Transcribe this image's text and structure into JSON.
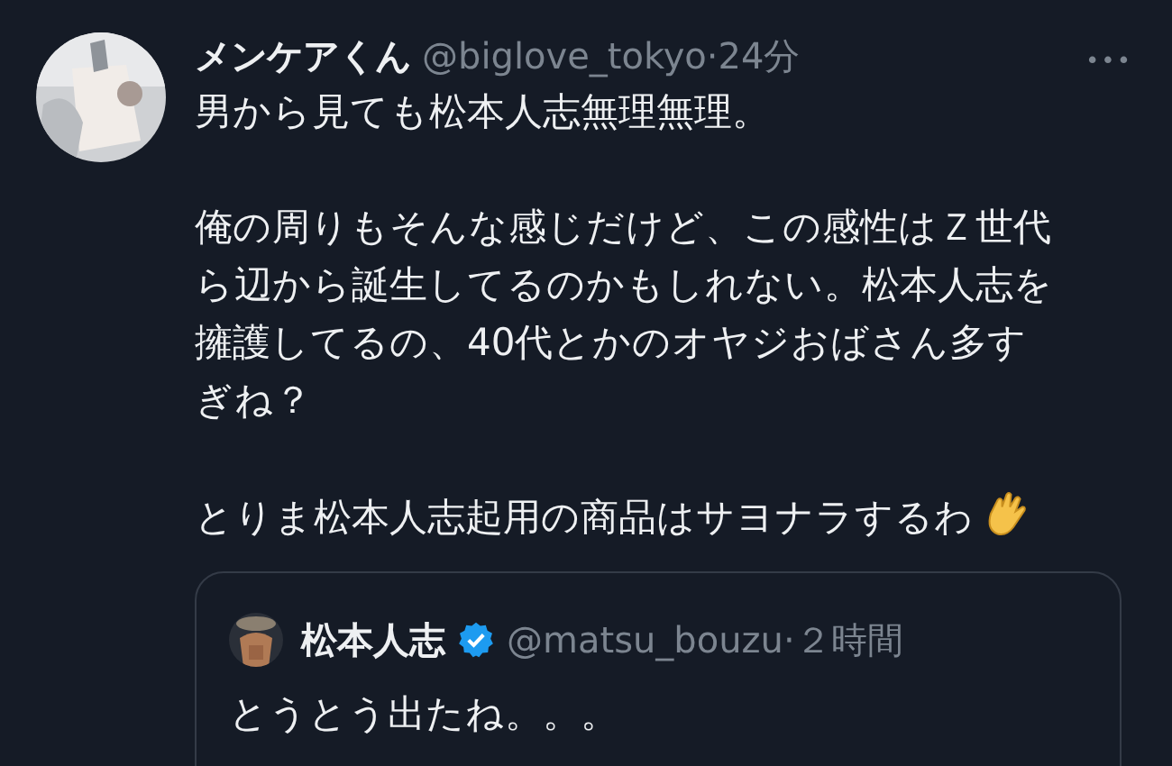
{
  "tweet": {
    "author": {
      "name": "メンケアくん",
      "handle": "@biglove_tokyo",
      "time": "·24分"
    },
    "more": "•••",
    "paragraphs": [
      "男から見ても松本人志無理無理。",
      "俺の周りもそんな感じだけど、この感性はＺ世代ら辺から誕生してるのかもしれない。松本人志を擁護してるの、40代とかのオヤジおばさん多すぎね？",
      "とりま松本人志起用の商品はサヨナラするわ"
    ],
    "quoted": {
      "author": {
        "name": "松本人志",
        "verified": true,
        "handle": "@matsu_bouzu",
        "time": "·２時間"
      },
      "text": "とうとう出たね。。。"
    }
  }
}
